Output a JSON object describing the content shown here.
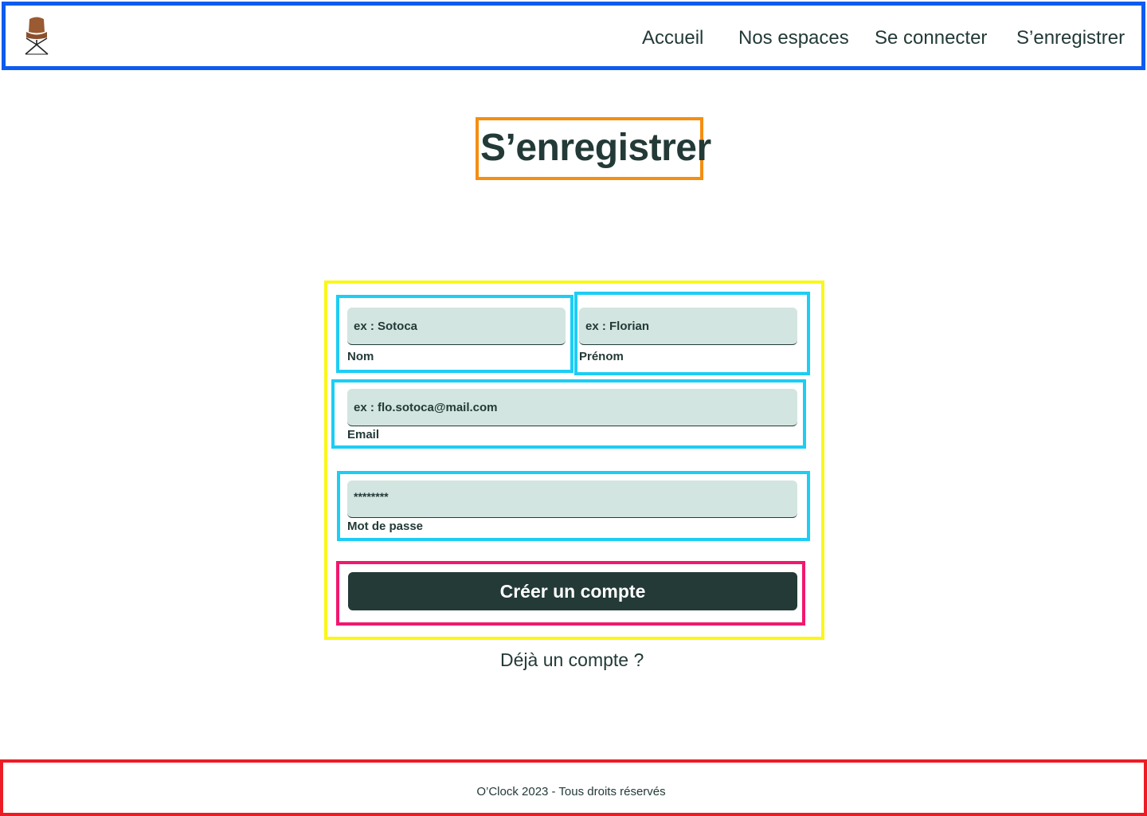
{
  "header": {
    "logo_icon": "office-chair-icon",
    "nav": [
      {
        "label": "Accueil"
      },
      {
        "label": "Nos espaces"
      },
      {
        "label": "Se connecter"
      },
      {
        "label": "S’enregistrer"
      }
    ]
  },
  "main": {
    "title": "S’enregistrer",
    "form": {
      "nom": {
        "placeholder": "ex : Sotoca",
        "label": "Nom"
      },
      "prenom": {
        "placeholder": "ex : Florian",
        "label": "Prénom"
      },
      "email": {
        "placeholder": "ex : flo.sotoca@mail.com",
        "label": "Email"
      },
      "password": {
        "value": "********",
        "label": "Mot de passe"
      },
      "submit_label": "Créer un compte"
    },
    "already_account": "Déjà un compte ?"
  },
  "footer": {
    "text": "O’Clock 2023 - Tous droits réservés"
  },
  "colors": {
    "primary": "#233a37",
    "input_bg": "#d3e5e0",
    "chair": "#9a5a32"
  }
}
